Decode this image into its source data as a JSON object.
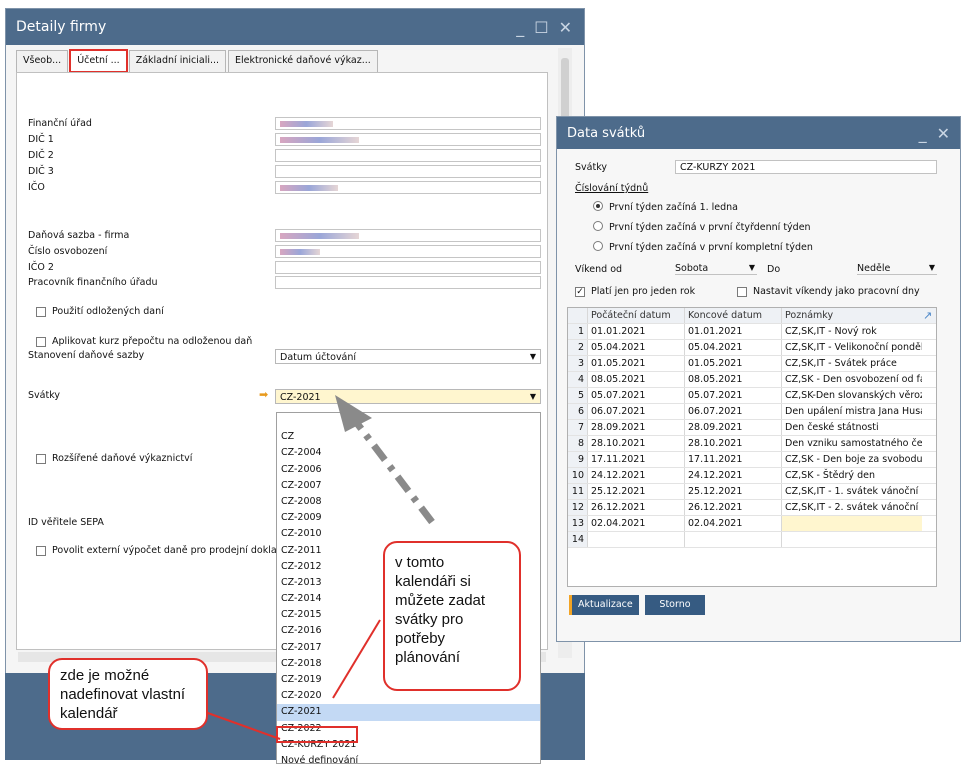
{
  "left_window": {
    "title": "Detaily firmy",
    "tabs": [
      "Všeob...",
      "Účetní ...",
      "Základní iniciali...",
      "Elektronické daňové výkaz..."
    ],
    "fields": [
      "Finanční úřad",
      "DIČ 1",
      "DIČ 2",
      "DIČ 3",
      "IČO",
      "Daňová sazba - firma",
      "Číslo osvobození",
      "IČO 2",
      "Pracovník finančního úřadu"
    ],
    "check_deferred": "Použití odložených daní",
    "check_rate": "Aplikovat kurz přepočtu na odloženou daň",
    "tax_rate_label": "Stanovení daňové sazby",
    "tax_rate_value": "Datum účtování",
    "holidays_label": "Svátky",
    "holidays_value": "CZ-2021",
    "check_extended": "Rozšířené daňové výkaznictví",
    "sepa_label": "ID věřitele SEPA",
    "check_external": "Povolit externí výpočet daně pro prodejní doklady",
    "dropdown": [
      "",
      "CZ",
      "CZ-2004",
      "CZ-2006",
      "CZ-2007",
      "CZ-2008",
      "CZ-2009",
      "CZ-2010",
      "CZ-2011",
      "CZ-2012",
      "CZ-2013",
      "CZ-2014",
      "CZ-2015",
      "CZ-2016",
      "CZ-2017",
      "CZ-2018",
      "CZ-2019",
      "CZ-2020",
      "CZ-2021",
      "CZ-2022",
      "CZ-KURZY 2021",
      "Nové definování"
    ]
  },
  "right_window": {
    "title": "Data svátků",
    "holidays_label": "Svátky",
    "holidays_value": "CZ-KURZY 2021",
    "week_numbering": "Číslování týdnů",
    "radios": [
      "První týden začíná 1. ledna",
      "První týden začíná v první čtyřdenní týden",
      "První týden začíná v první kompletní týden"
    ],
    "weekend_from": "Víkend od",
    "weekend_from_value": "Sobota",
    "weekend_to": "Do",
    "weekend_to_value": "Neděle",
    "check_one_year": "Platí jen pro jeden rok",
    "check_workdays": "Nastavit víkendy jako pracovní dny",
    "columns": [
      "Počáteční datum",
      "Koncové datum",
      "Poznámky"
    ],
    "rows": [
      [
        "1",
        "01.01.2021",
        "01.01.2021",
        "CZ,SK,IT - Nový rok"
      ],
      [
        "2",
        "05.04.2021",
        "05.04.2021",
        "CZ,SK,IT - Velikonoční pondělí"
      ],
      [
        "3",
        "01.05.2021",
        "01.05.2021",
        "CZ,SK,IT - Svátek práce"
      ],
      [
        "4",
        "08.05.2021",
        "08.05.2021",
        "CZ,SK - Den osvobození od fa"
      ],
      [
        "5",
        "05.07.2021",
        "05.07.2021",
        "CZ,SK-Den slovanských věroz"
      ],
      [
        "6",
        "06.07.2021",
        "06.07.2021",
        "Den upálení mistra Jana Husa"
      ],
      [
        "7",
        "28.09.2021",
        "28.09.2021",
        "Den české státnosti"
      ],
      [
        "8",
        "28.10.2021",
        "28.10.2021",
        "Den vzniku samostatného česl"
      ],
      [
        "9",
        "17.11.2021",
        "17.11.2021",
        "CZ,SK - Den boje za svobodu"
      ],
      [
        "10",
        "24.12.2021",
        "24.12.2021",
        "CZ,SK - Štědrý den"
      ],
      [
        "11",
        "25.12.2021",
        "25.12.2021",
        "CZ,SK,IT - 1. svátek vánoční"
      ],
      [
        "12",
        "26.12.2021",
        "26.12.2021",
        "CZ,SK,IT - 2. svátek vánoční"
      ],
      [
        "13",
        "02.04.2021",
        "02.04.2021",
        ""
      ],
      [
        "14",
        "",
        "",
        ""
      ]
    ],
    "btn_update": "Aktualizace",
    "btn_cancel": "Storno"
  },
  "callouts": {
    "left": "zde je možné nadefinovat vlastní kalendář",
    "right": "v tomto kalendáři si můžete zadat svátky pro potřeby plánování"
  }
}
